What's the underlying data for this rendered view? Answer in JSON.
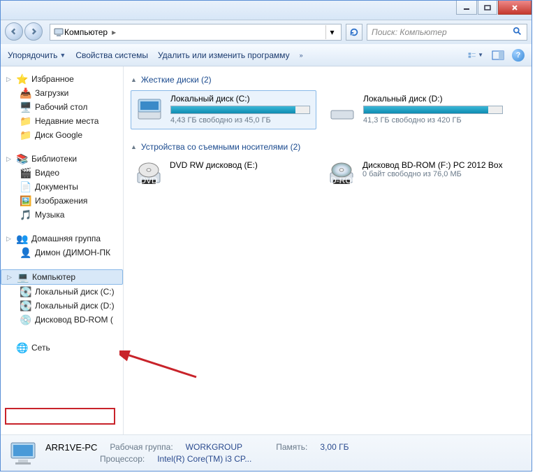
{
  "address": {
    "location": "Компьютер"
  },
  "search": {
    "placeholder": "Поиск: Компьютер"
  },
  "toolbar": {
    "organize": "Упорядочить",
    "sysprops": "Свойства системы",
    "uninstall": "Удалить или изменить программу"
  },
  "nav": {
    "favorites": {
      "label": "Избранное",
      "items": [
        "Загрузки",
        "Рабочий стол",
        "Недавние места",
        "Диск Google"
      ]
    },
    "libraries": {
      "label": "Библиотеки",
      "items": [
        "Видео",
        "Документы",
        "Изображения",
        "Музыка"
      ]
    },
    "homegroup": {
      "label": "Домашняя группа",
      "items": [
        "Димон (ДИМОН-ПК"
      ]
    },
    "computer": {
      "label": "Компьютер",
      "items": [
        "Локальный диск (C:)",
        "Локальный диск (D:)",
        "Дисковод BD-ROM ("
      ]
    },
    "network": {
      "label": "Сеть"
    }
  },
  "content": {
    "hdd": {
      "title": "Жесткие диски (2)",
      "drives": [
        {
          "name": "Локальный диск (C:)",
          "free": "4,43 ГБ свободно из 45,0 ГБ",
          "fill": 90
        },
        {
          "name": "Локальный диск (D:)",
          "free": "41,3 ГБ свободно из 420 ГБ",
          "fill": 90
        }
      ]
    },
    "removable": {
      "title": "Устройства со съемными носителями (2)",
      "devices": [
        {
          "name": "DVD RW дисковод (E:)",
          "sub": ""
        },
        {
          "name": "Дисковод BD-ROM (F:) PC 2012 Box",
          "sub": "0 байт свободно из 76,0 МБ"
        }
      ]
    }
  },
  "status": {
    "name": "ARR1VE-PC",
    "wg_label": "Рабочая группа:",
    "wg": "WORKGROUP",
    "mem_label": "Память:",
    "mem": "3,00 ГБ",
    "cpu_label": "Процессор:",
    "cpu": "Intel(R) Core(TM) i3 CP..."
  }
}
